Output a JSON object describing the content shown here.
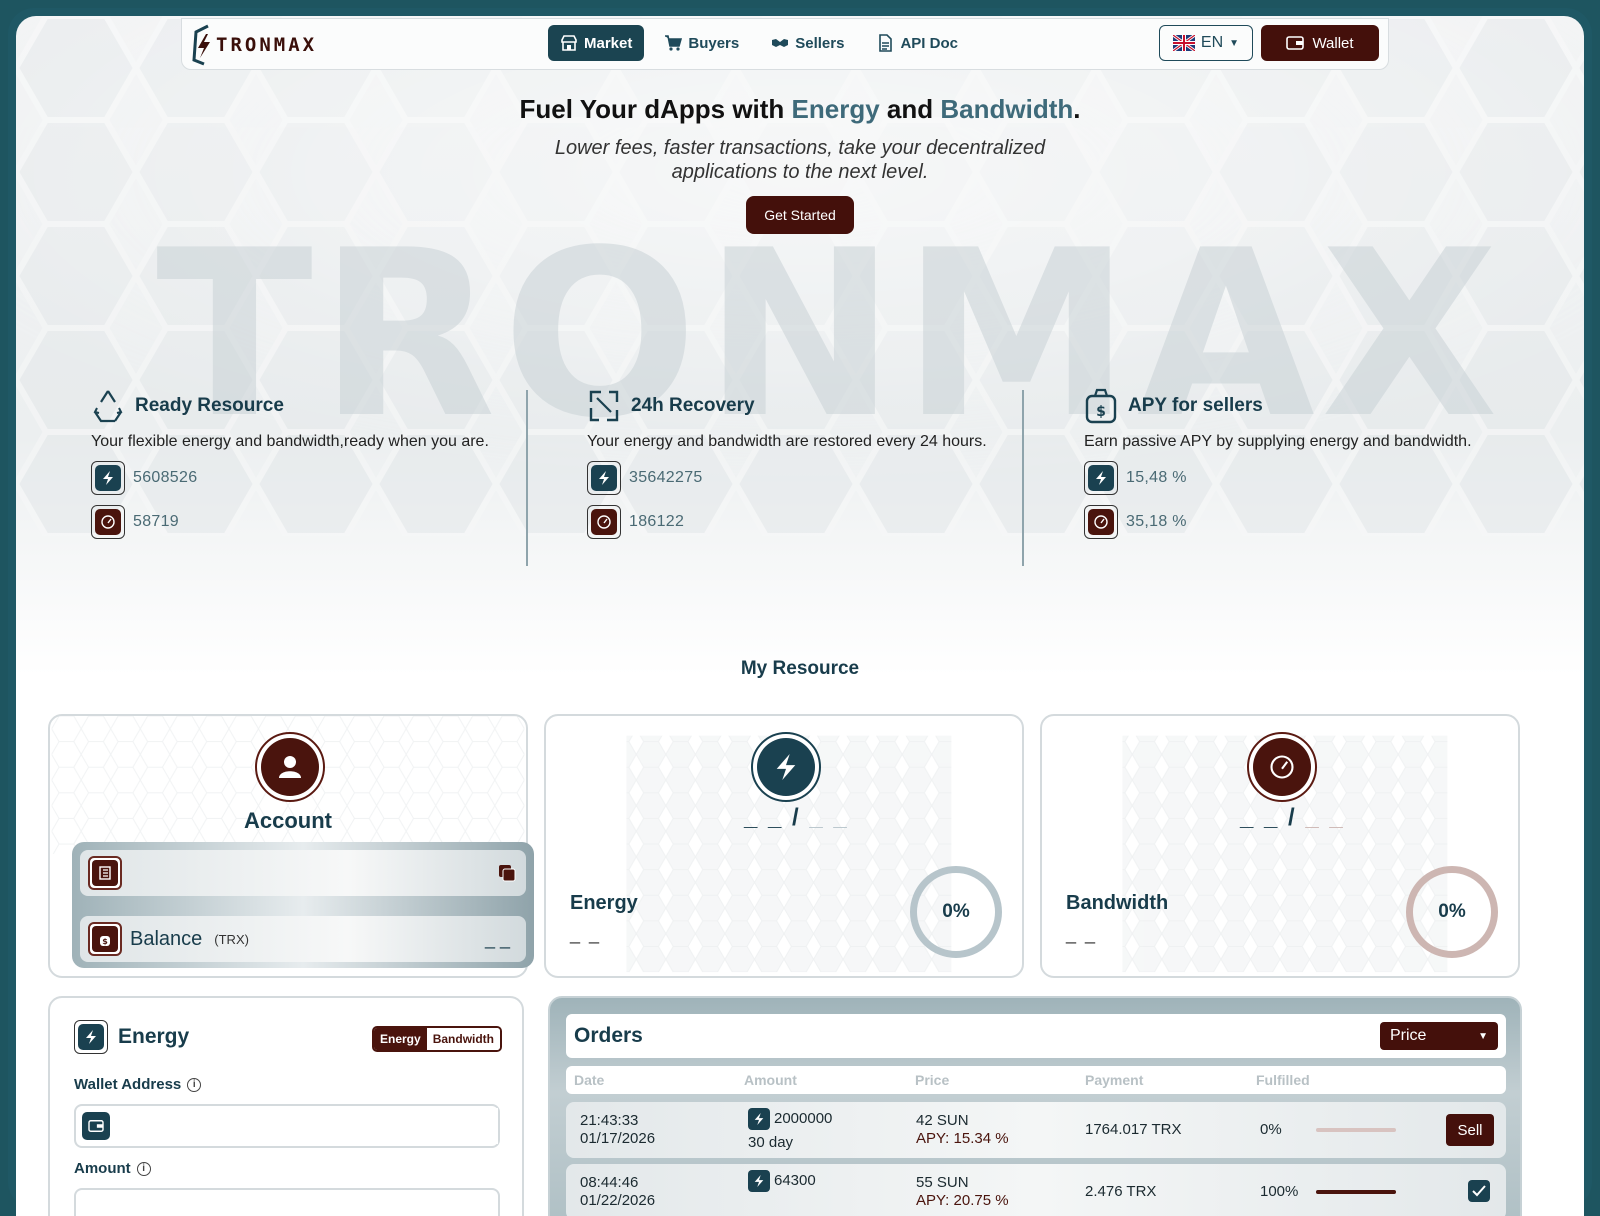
{
  "nav": {
    "logo_text": "TRONMAX",
    "links": [
      {
        "label": "Market",
        "icon": "store-icon",
        "active": true
      },
      {
        "label": "Buyers",
        "icon": "cart-icon",
        "active": false
      },
      {
        "label": "Sellers",
        "icon": "handshake-icon",
        "active": false
      },
      {
        "label": "API Doc",
        "icon": "document-icon",
        "active": false
      }
    ],
    "language": "EN",
    "wallet_label": "Wallet"
  },
  "hero": {
    "title_part1": "Fuel Your dApps with ",
    "title_accent1": "Energy",
    "title_part2": " and ",
    "title_accent2": "Bandwidth",
    "title_part3": ".",
    "subtitle": "Lower fees, faster transactions, take your decentralized applications to the next level.",
    "cta_label": "Get Started",
    "watermark": "TRONMAX"
  },
  "features": [
    {
      "title": "Ready Resource",
      "description": "Your flexible energy and bandwidth,ready when you are.",
      "energy_value": "5608526",
      "bandwidth_value": "58719"
    },
    {
      "title": "24h Recovery",
      "description": "Your energy and bandwidth are restored every 24 hours.",
      "energy_value": "35642275",
      "bandwidth_value": "186122"
    },
    {
      "title": "APY for sellers",
      "description": "Earn passive APY by supplying energy and bandwidth.",
      "energy_value": "15,48 %",
      "bandwidth_value": "35,18 %"
    }
  ],
  "my_resource": {
    "section_title": "My Resource",
    "account": {
      "label": "Account",
      "balance_label": "Balance",
      "balance_unit": "(TRX)",
      "balance_value": "_ _"
    },
    "energy": {
      "label": "Energy",
      "ratio_left": "_ _",
      "ratio_sep": "/",
      "ratio_right": "_ _",
      "value": "_ _",
      "percent": "0%"
    },
    "bandwidth": {
      "label": "Bandwidth",
      "ratio_left": "_ _",
      "ratio_sep": "/",
      "ratio_right": "_ _",
      "value": "_ _",
      "percent": "0%"
    }
  },
  "order_form": {
    "title": "Energy",
    "toggle": [
      "Energy",
      "Bandwidth"
    ],
    "wallet_label": "Wallet Address",
    "wallet_placeholder": "",
    "amount_label": "Amount"
  },
  "orders": {
    "title": "Orders",
    "sort_select": "Price",
    "columns": [
      "Date",
      "Amount",
      "Price",
      "Payment",
      "Fulfilled"
    ],
    "rows": [
      {
        "time": "21:43:33",
        "date": "01/17/2026",
        "amount": "2000000",
        "duration": "30 day",
        "price": "42 SUN",
        "apy": "APY: 15.34 %",
        "payment": "1764.017 TRX",
        "fulfilled": "0%",
        "fulfilled_fraction": 0.0,
        "action": "Sell"
      },
      {
        "time": "08:44:46",
        "date": "01/22/2026",
        "amount": "64300",
        "duration": "",
        "price": "55 SUN",
        "apy": "APY: 20.75 %",
        "payment": "2.476 TRX",
        "fulfilled": "100%",
        "fulfilled_fraction": 1.0,
        "action": "check"
      }
    ]
  },
  "colors": {
    "primary_dark": "#1a4150",
    "accent_maroon": "#44100b",
    "accent_teal_text": "#3e6a7a"
  }
}
